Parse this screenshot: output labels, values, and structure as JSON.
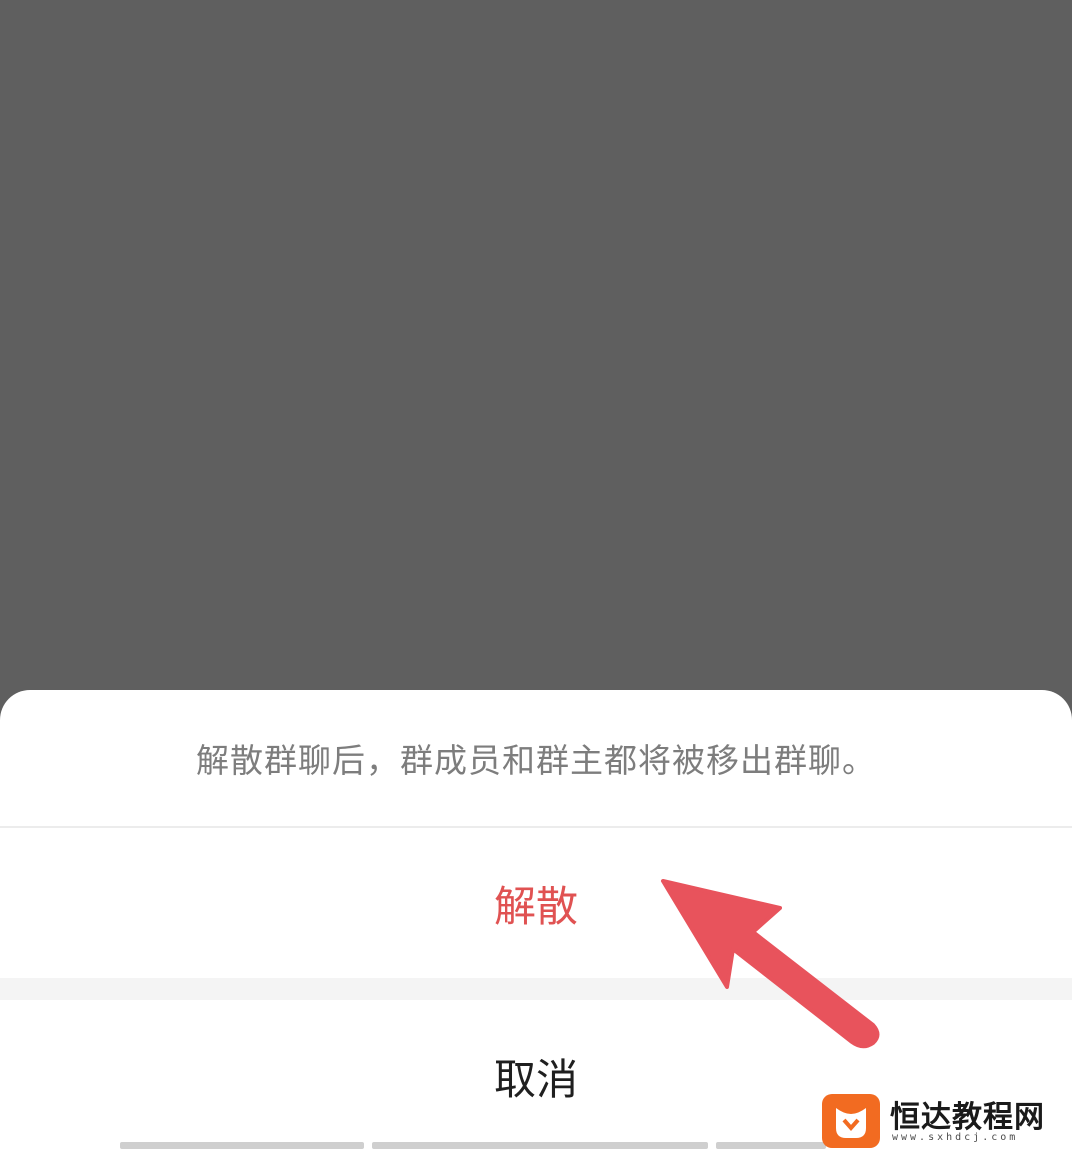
{
  "dialog": {
    "message": "解散群聊后，群成员和群主都将被移出群聊。",
    "confirm_label": "解散",
    "cancel_label": "取消"
  },
  "colors": {
    "overlay": "#5f5f5f",
    "sheet": "#ffffff",
    "confirm_text": "#e05252",
    "cancel_text": "#1f1f1f",
    "message_text": "#7d7d7d",
    "annotation_arrow": "#e8535c"
  },
  "annotation": {
    "icon": "arrow-icon"
  },
  "watermark": {
    "site_name": "恒达教程网",
    "url": "www.sxhdcj.com"
  }
}
